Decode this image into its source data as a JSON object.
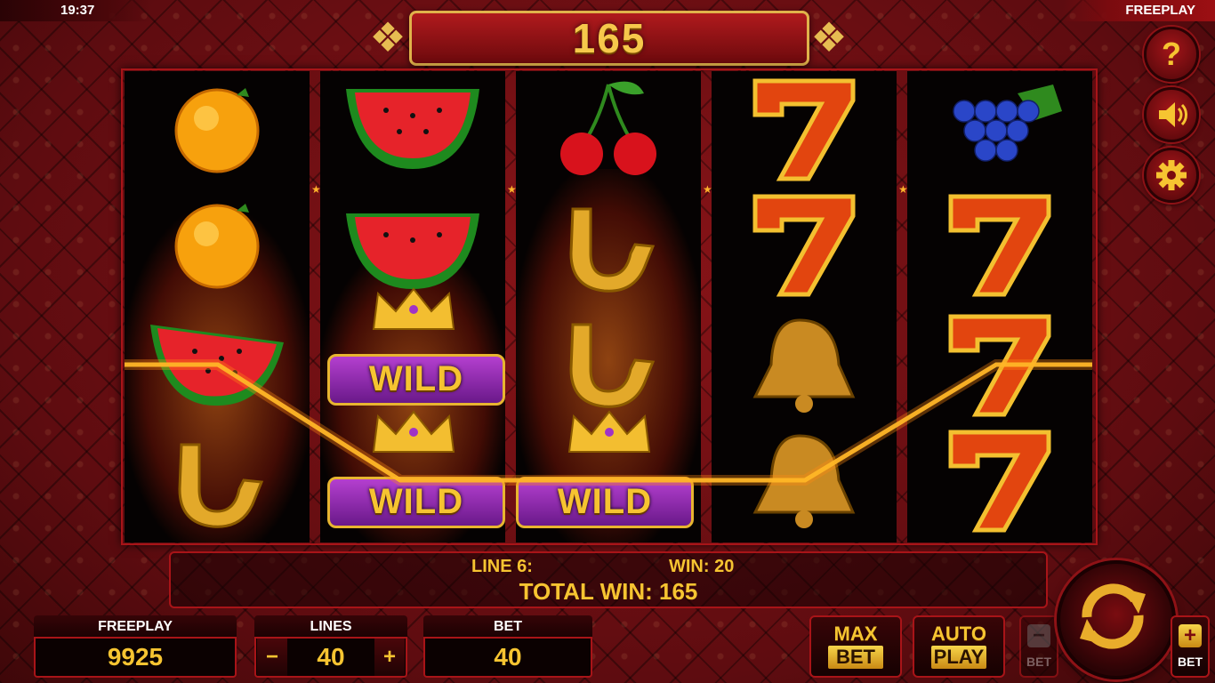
{
  "status_bar": {
    "time": "19:37",
    "mode": "FREEPLAY"
  },
  "banner": {
    "value": "165"
  },
  "side_buttons": {
    "help_glyph": "?",
    "help_icon": "question-icon",
    "sound_icon": "speaker-icon",
    "settings_icon": "gear-icon"
  },
  "reels": [
    {
      "symbols": [
        "orange",
        "orange",
        "watermelon",
        "horseshoe"
      ]
    },
    {
      "symbols": [
        "watermelon",
        "watermelon",
        "wild",
        "wild"
      ]
    },
    {
      "symbols": [
        "cherries",
        "horseshoe",
        "horseshoe",
        "wild"
      ]
    },
    {
      "symbols": [
        "seven",
        "seven",
        "bell",
        "bell"
      ]
    },
    {
      "symbols": [
        "grapes",
        "seven",
        "seven",
        "seven"
      ]
    }
  ],
  "wild_label": "WILD",
  "win": {
    "line_label": "LINE 6:",
    "line_win_label": "WIN: 20",
    "total_label": "TOTAL WIN: 165"
  },
  "bottom": {
    "balance_label": "FREEPLAY",
    "balance_value": "9925",
    "lines_label": "LINES",
    "lines_value": "40",
    "lines_minus": "−",
    "lines_plus": "+",
    "bet_label": "BET",
    "bet_value": "40",
    "max_bet": {
      "line1": "MAX",
      "line2": "BET"
    },
    "auto_play": {
      "line1": "AUTO",
      "line2": "PLAY"
    },
    "bet_minus": {
      "sign": "−",
      "caption": "BET"
    },
    "bet_plus": {
      "sign": "+",
      "caption": "BET"
    }
  },
  "colors": {
    "gold": "#f6c431",
    "accent_red": "#a81418",
    "background": "#5a0a0e"
  }
}
